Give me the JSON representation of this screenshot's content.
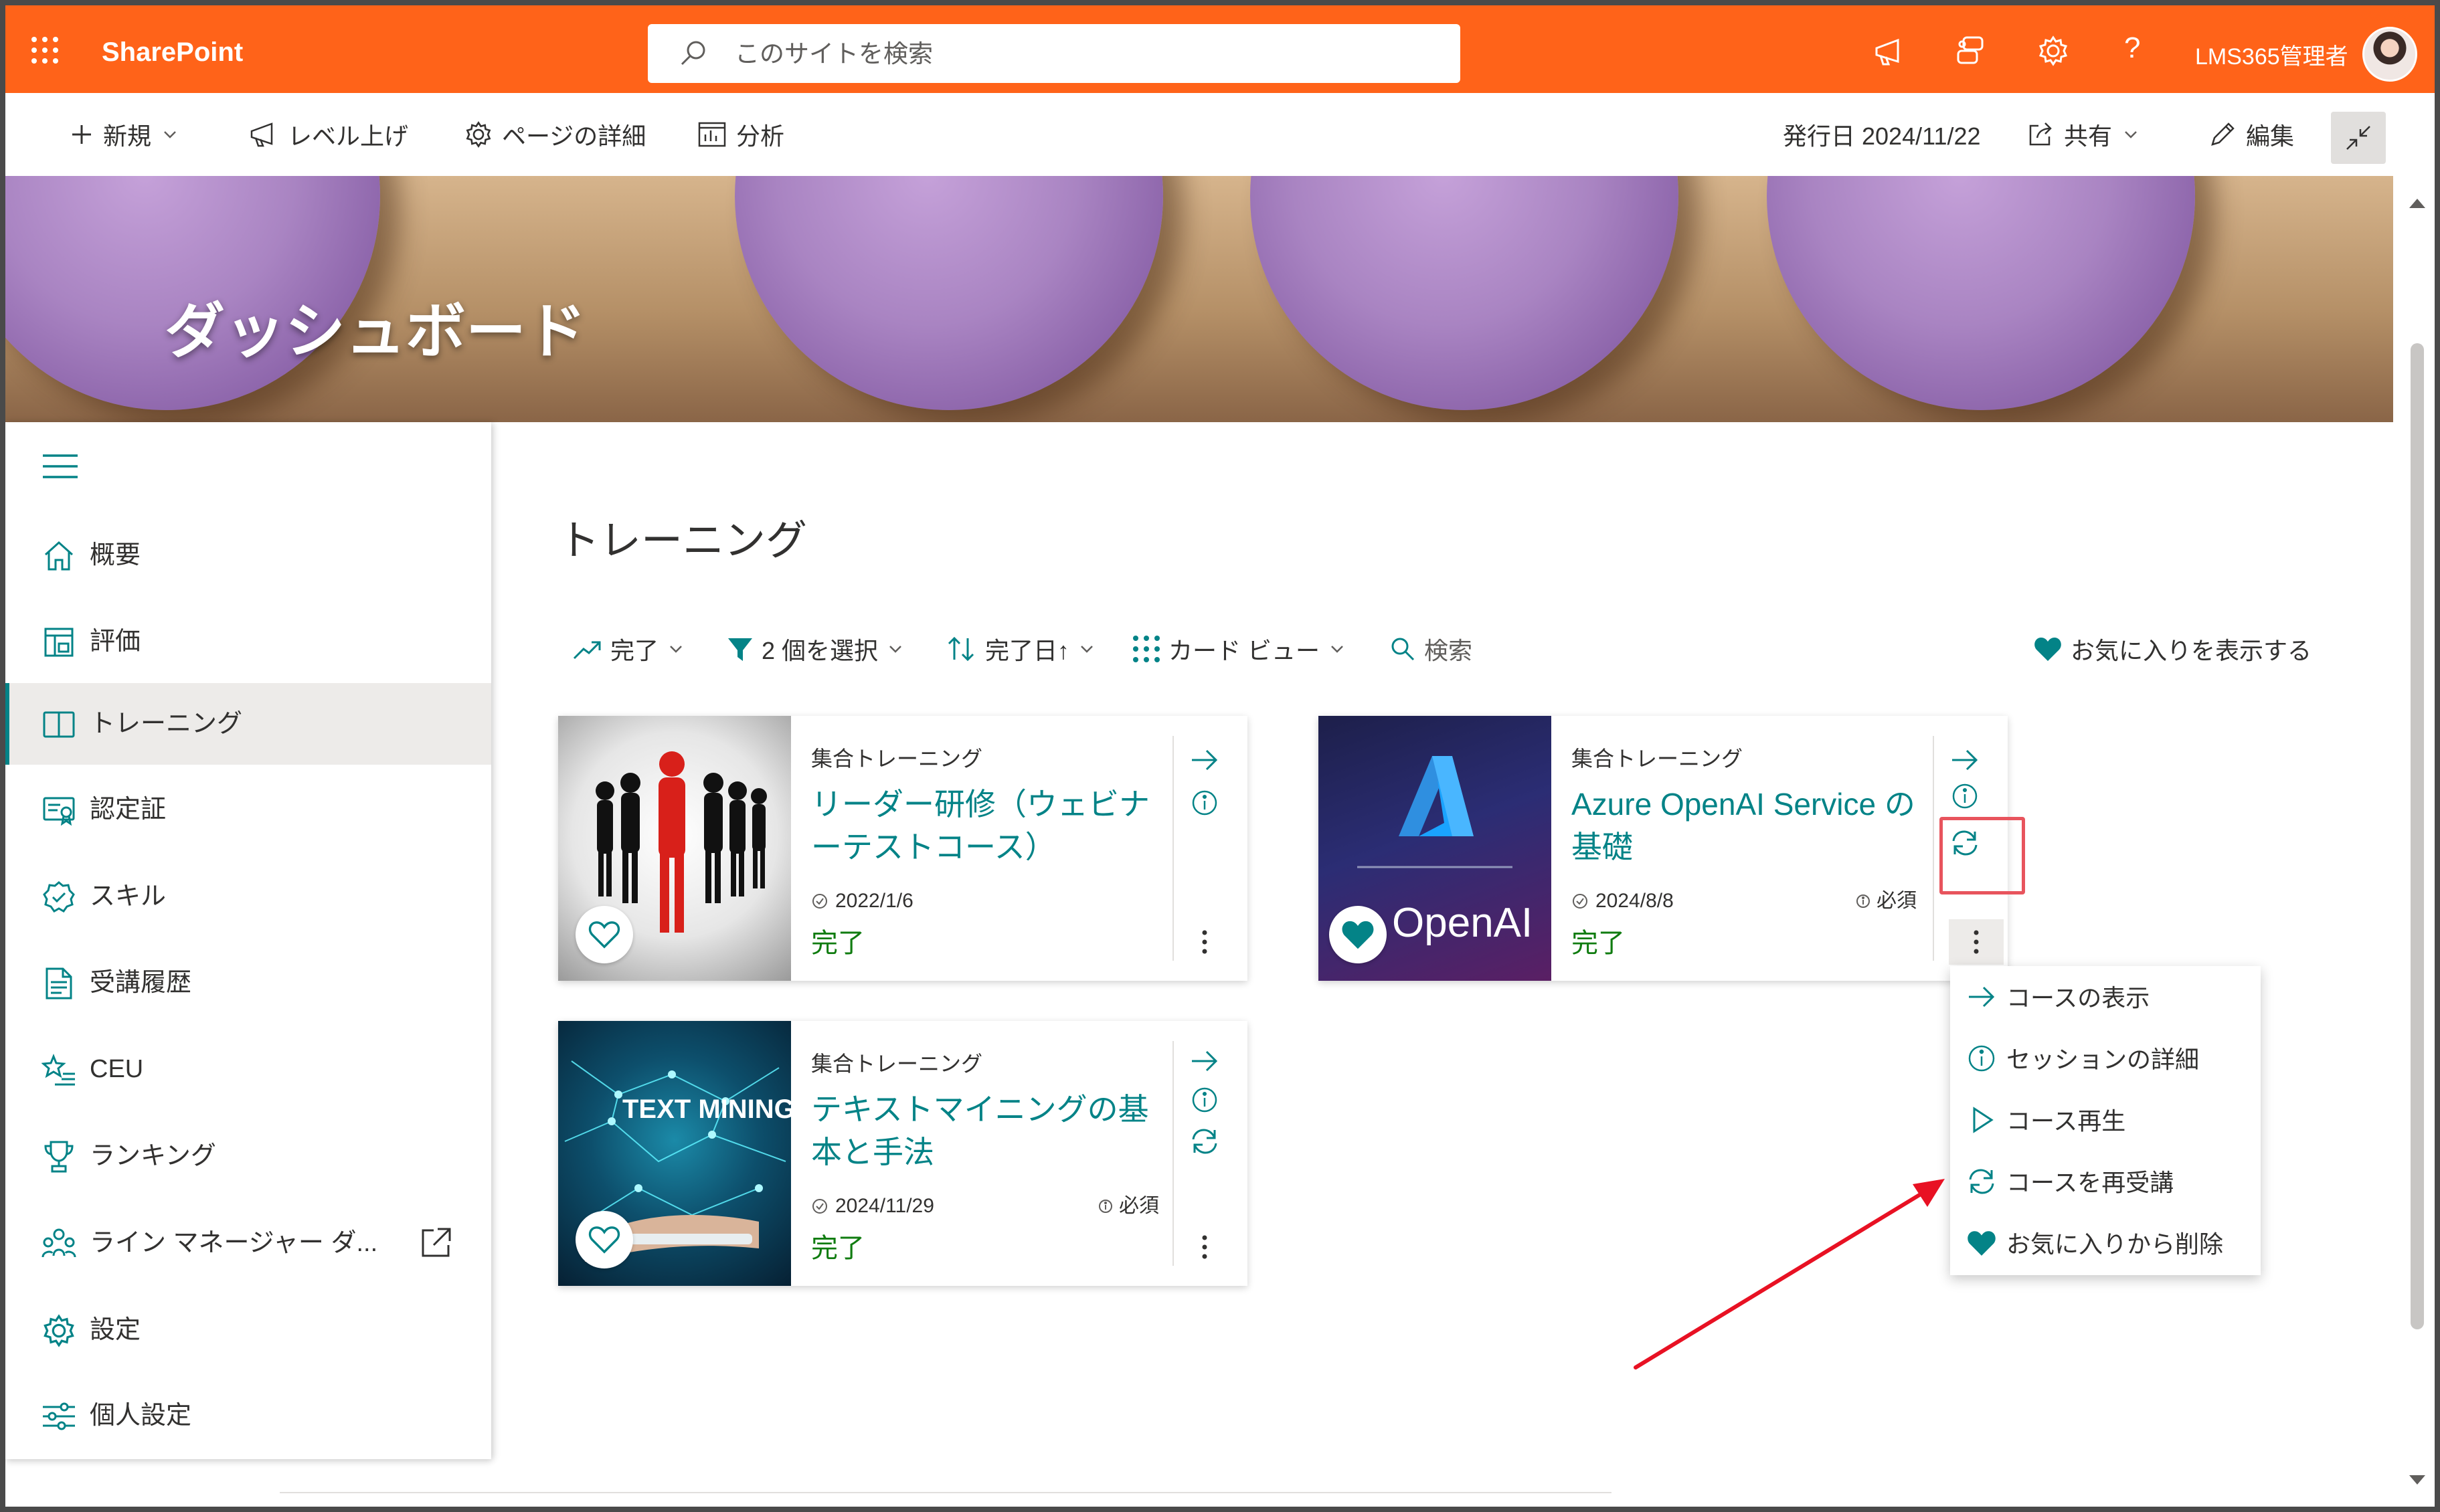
{
  "suite": {
    "brand": "SharePoint",
    "search_placeholder": "このサイトを検索",
    "admin_name": "LMS365管理者"
  },
  "command_bar": {
    "new_label": "新規",
    "boost_label": "レベル上げ",
    "page_details_label": "ページの詳細",
    "analytics_label": "分析",
    "published": "発行日 2024/11/22",
    "share_label": "共有",
    "edit_label": "編集"
  },
  "banner": {
    "title": "ダッシュボード"
  },
  "nav": {
    "items": [
      {
        "label": "概要",
        "icon": "home-icon"
      },
      {
        "label": "評価",
        "icon": "assessment-icon"
      },
      {
        "label": "トレーニング",
        "icon": "book-icon"
      },
      {
        "label": "認定証",
        "icon": "certificate-icon"
      },
      {
        "label": "スキル",
        "icon": "skill-badge-icon"
      },
      {
        "label": "受講履歴",
        "icon": "transcript-icon"
      },
      {
        "label": "CEU",
        "icon": "star-list-icon"
      },
      {
        "label": "ランキング",
        "icon": "trophy-icon"
      },
      {
        "label": "ライン マネージャー ダ...",
        "icon": "people-icon"
      },
      {
        "label": "設定",
        "icon": "gear-icon"
      },
      {
        "label": "個人設定",
        "icon": "sliders-icon"
      }
    ]
  },
  "main": {
    "title": "トレーニング",
    "filters": {
      "status": "完了",
      "selected": "2 個を選択",
      "sort": "完了日↑",
      "view": "カード ビュー",
      "search": "検索",
      "favorites": "お気に入りを表示する"
    },
    "cards": [
      {
        "type": "集合トレーニング",
        "title": "リーダー研修（ウェビナーテストコース）",
        "date": "2022/1/6",
        "required": "",
        "status": "完了"
      },
      {
        "type": "集合トレーニング",
        "title": "Azure OpenAI Service の基礎",
        "date": "2024/8/8",
        "required": "必須",
        "status": "完了",
        "image_text": "OpenAI"
      },
      {
        "type": "集合トレーニング",
        "title": "テキストマイニングの基本と手法",
        "date": "2024/11/29",
        "required": "必須",
        "status": "完了",
        "image_text": "TEXT MINING"
      }
    ]
  },
  "context_menu": {
    "items": [
      {
        "label": "コースの表示",
        "icon": "arrow-right-icon"
      },
      {
        "label": "セッションの詳細",
        "icon": "info-icon"
      },
      {
        "label": "コース再生",
        "icon": "play-icon"
      },
      {
        "label": "コースを再受講",
        "icon": "retake-icon"
      },
      {
        "label": "お気に入りから削除",
        "icon": "heart-filled-icon"
      }
    ]
  },
  "colors": {
    "suite_bar": "#ff6319",
    "accent": "#038387",
    "complete": "#107c10",
    "highlight": "#e8545d"
  }
}
